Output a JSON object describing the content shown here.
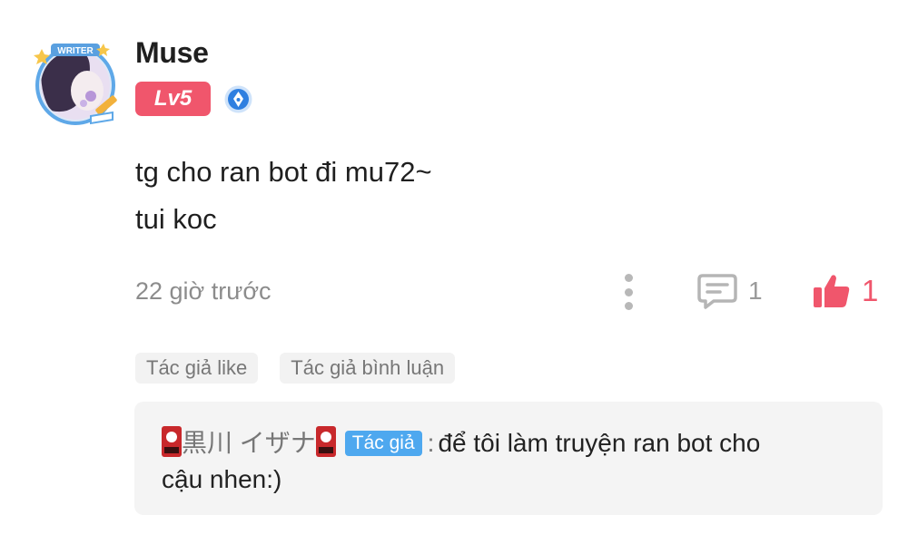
{
  "comment": {
    "username": "Muse",
    "level": "Lv5",
    "avatar_badge": "WRITER",
    "text_lines": [
      "tg cho ran bot đi mu72~",
      "tui koc"
    ],
    "timestamp": "22 giờ trước",
    "reply_count": "1",
    "like_count": "1"
  },
  "tags": [
    "Tác giả like",
    "Tác giả bình luận"
  ],
  "reply": {
    "author": "黒川 イザナ",
    "author_badge": "Tác giả",
    "separator": ":",
    "text_line1": "để tôi làm truyện ran bot cho",
    "text_line2": "cậu nhen:)"
  },
  "icons": {
    "avatar": "avatar-writer-frame",
    "verified": "pen-nib-icon",
    "more": "more-vertical-icon",
    "reply": "comment-bubble-icon",
    "like": "thumbs-up-icon",
    "card": "flag-card-icon"
  },
  "colors": {
    "accent_pink": "#f0566c",
    "author_badge_blue": "#4ea8ef",
    "verified_blue": "#2f7fe0"
  }
}
